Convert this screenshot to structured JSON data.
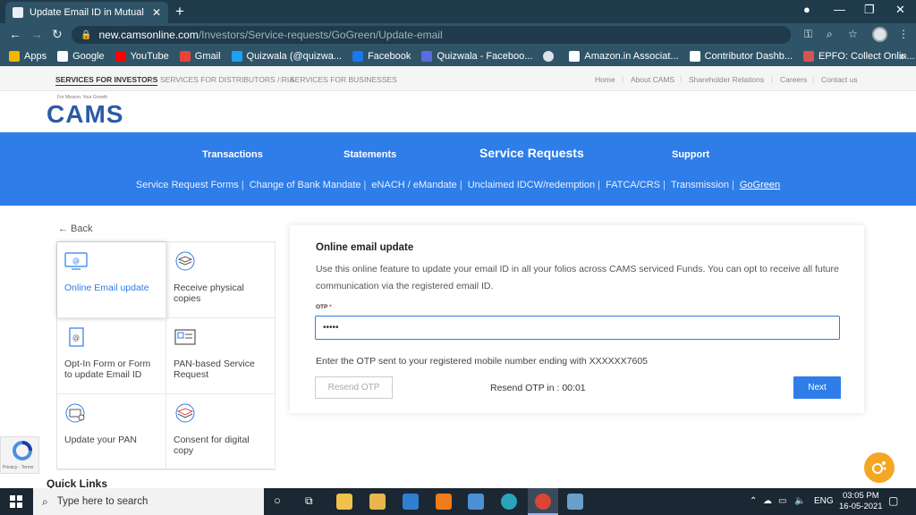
{
  "browser": {
    "tab_title": "Update Email ID in Mutual Fund",
    "tab_close": "✕",
    "new_tab": "+",
    "url_host": "new.camsonline.com",
    "url_path": "/Investors/Service-requests/GoGreen/Update-email",
    "bookmarks": [
      {
        "label": "Apps",
        "color": "#f4b400"
      },
      {
        "label": "Google",
        "color": "#ffffff"
      },
      {
        "label": "YouTube",
        "color": "#ff0000"
      },
      {
        "label": "Gmail",
        "color": "#ea4335"
      },
      {
        "label": "Quizwala (@quizwa...",
        "color": "#1da1f2"
      },
      {
        "label": "Facebook",
        "color": "#1877f2"
      },
      {
        "label": "Quizwala - Faceboo...",
        "color": "#5b6be0"
      },
      {
        "label": "Amazon.in Associat...",
        "color": "#ffffff"
      },
      {
        "label": "Contributor Dashb...",
        "color": "#ffffff"
      },
      {
        "label": "EPFO: Collect Onlin...",
        "color": "#d9534f"
      }
    ],
    "bookmarks_more": "»"
  },
  "site": {
    "segments": [
      "SERVICES FOR INVESTORS",
      "SERVICES FOR DISTRIBUTORS / RIA",
      "SERVICES FOR BUSINESSES"
    ],
    "top_links": [
      "Home",
      "About CAMS",
      "Shareholder Relations",
      "Careers",
      "Contact us"
    ],
    "logo_text": "CAMS",
    "logo_tag": "For Mission. Your Growth",
    "main_menu": [
      "Transactions",
      "Statements",
      "Service Requests",
      "Support"
    ],
    "sub_menu": [
      "Service Request Forms",
      "Change of Bank Mandate",
      "eNACH / eMandate",
      "Unclaimed IDCW/redemption",
      "FATCA/CRS",
      "Transmission",
      "GoGreen"
    ]
  },
  "left_panel": {
    "back": "← Back",
    "options": [
      "Online Email update",
      "Receive physical copies",
      "Opt-In Form or Form to update Email ID",
      "PAN-based Service Request",
      "Update your PAN",
      "Consent for digital copy"
    ],
    "quick_links": "Quick Links"
  },
  "form": {
    "title": "Online email update",
    "description": "Use this online feature to update your email ID in all your folios across CAMS serviced Funds. You can opt to receive all future communication via the registered email ID.",
    "otp_label": "OTP",
    "otp_required": "*",
    "otp_value": "•••••",
    "otp_hint": "Enter the OTP sent to your registered mobile number ending with XXXXXX7605",
    "resend_label": "Resend OTP",
    "timer_text": "Resend OTP in : 00:01",
    "next_label": "Next"
  },
  "recaptcha": {
    "text": "Privacy - Terms"
  },
  "taskbar": {
    "search_placeholder": "Type here to search",
    "language": "ENG",
    "time": "03:05 PM",
    "date": "16-05-2021"
  },
  "colors": {
    "accent": "#2e7de9",
    "chrome_dark": "#1f3a4a",
    "chrome_mid": "#2f5467"
  }
}
